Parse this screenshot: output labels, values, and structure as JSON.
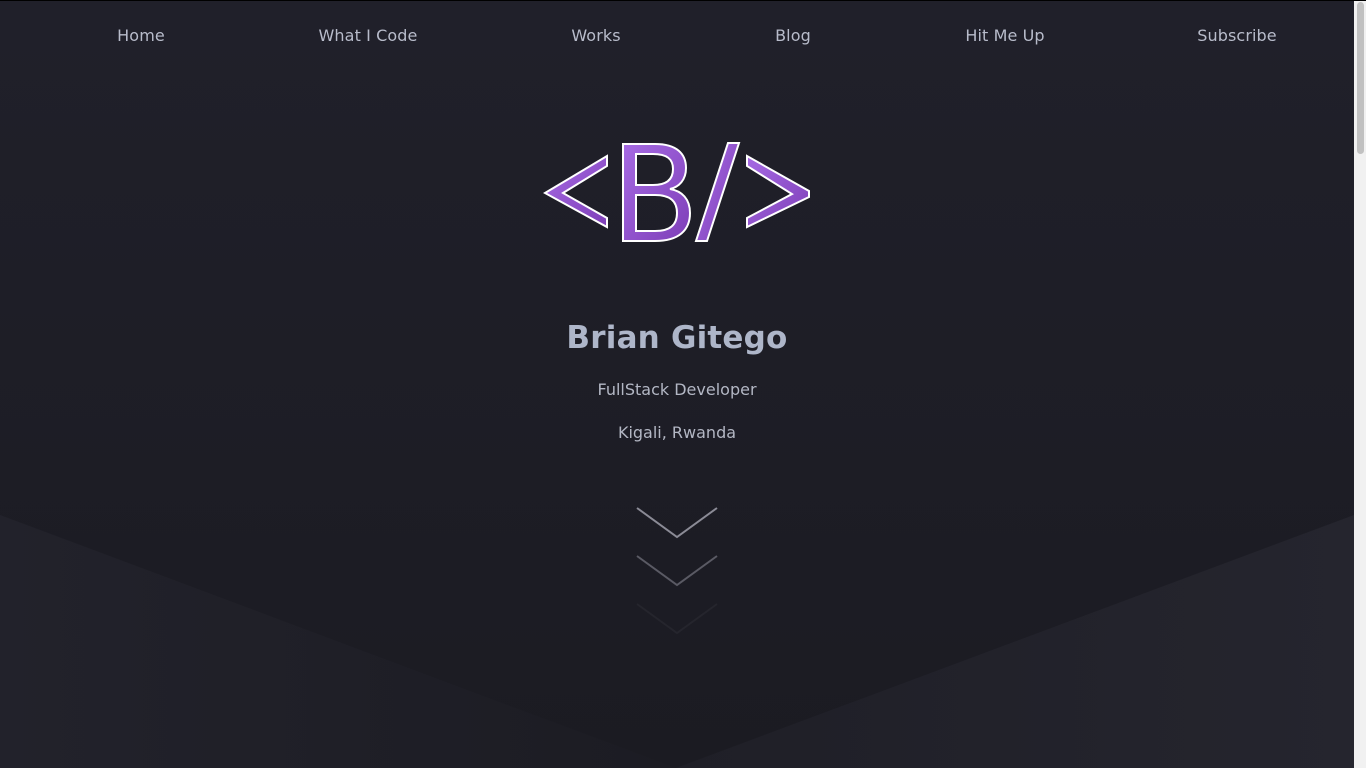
{
  "nav": {
    "items": [
      {
        "label": "Home"
      },
      {
        "label": "What I Code"
      },
      {
        "label": "Works"
      },
      {
        "label": "Blog"
      },
      {
        "label": "Hit Me Up"
      },
      {
        "label": "Subscribe"
      }
    ]
  },
  "logo": {
    "text": "<B/>",
    "icon": "code-bracket-logo",
    "fill_color": "#9b59d9",
    "stroke_color": "#ffffff"
  },
  "hero": {
    "name": "Brian Gitego",
    "role": "FullStack Developer",
    "location": "Kigali, Rwanda"
  },
  "scroll_indicator": {
    "icon": "chevron-down-icon",
    "count": 3,
    "color": "#9a9aa6"
  },
  "colors": {
    "background": "#1c1c23",
    "background_light": "#22222b",
    "nav_text": "#b8bccb",
    "name_text": "#aeb6c9",
    "accent": "#9b59d9"
  }
}
